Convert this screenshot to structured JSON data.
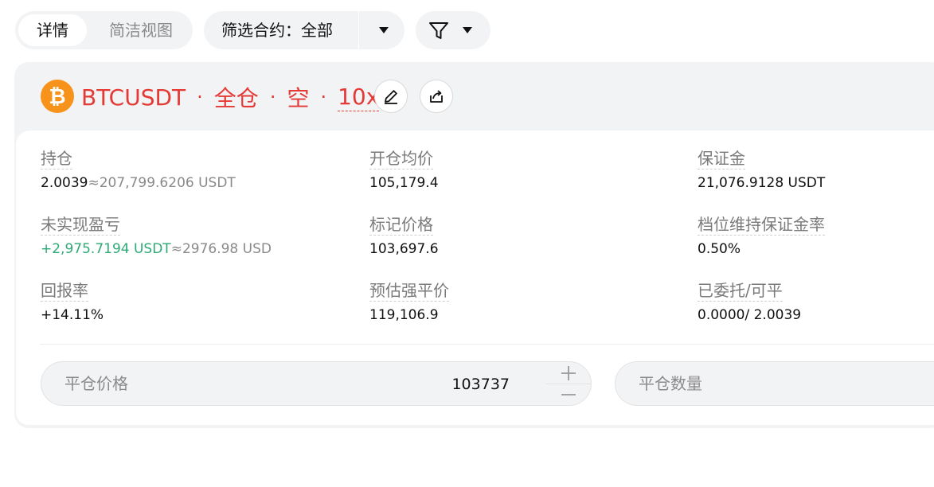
{
  "toolbar": {
    "view_detail": "详情",
    "view_compact": "简洁视图",
    "contract_filter_label": "筛选合约：",
    "contract_filter_value": "全部"
  },
  "position": {
    "symbol": "BTCUSDT",
    "margin_mode": "全仓",
    "side": "空",
    "leverage": "10x",
    "coin_icon": "bitcoin-icon",
    "fields": {
      "holding": {
        "label": "持仓",
        "qty": "2.0039",
        "approx": "≈207,799.6206 USDT"
      },
      "entry_price": {
        "label": "开仓均价",
        "value": "105,179.4"
      },
      "margin": {
        "label": "保证金",
        "value": "21,076.9128 USDT"
      },
      "unrealized_pnl": {
        "label": "未实现盈亏",
        "value": "+2,975.7194 USDT",
        "approx": "≈2976.98 USD"
      },
      "mark_price": {
        "label": "标记价格",
        "value": "103,697.6"
      },
      "maint_margin_rate": {
        "label": "档位维持保证金率",
        "value": "0.50%"
      },
      "roe": {
        "label": "回报率",
        "value": "+14.11%"
      },
      "liq_price": {
        "label": "预估强平价",
        "value": "119,106.9"
      },
      "entrusted_closable": {
        "label": "已委托/可平",
        "value": "0.0000/ 2.0039"
      }
    },
    "close_price": {
      "placeholder": "平仓价格",
      "value": "103737"
    },
    "close_qty": {
      "placeholder": "平仓数量"
    }
  },
  "colors": {
    "short_red": "#e53935",
    "profit_green": "#2eaa76",
    "liq_orange": "#f08c3c",
    "btc_orange": "#f7931a"
  }
}
